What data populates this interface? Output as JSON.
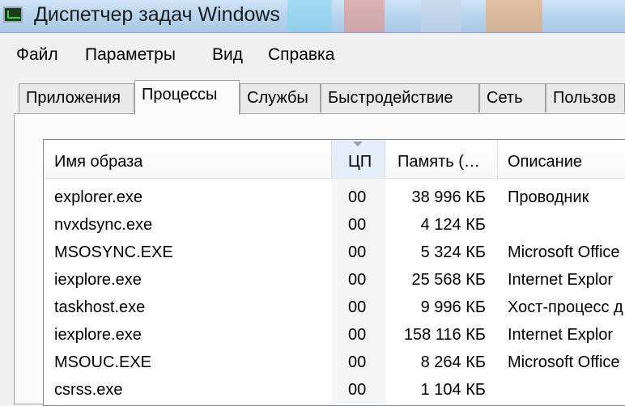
{
  "window": {
    "title": "Диспетчер задач Windows"
  },
  "menu": [
    "Файл",
    "Параметры",
    "Вид",
    "Справка"
  ],
  "tabs": [
    "Приложения",
    "Процессы",
    "Службы",
    "Быстродействие",
    "Сеть",
    "Пользов"
  ],
  "active_tab": "Процессы",
  "columns": [
    "Имя образа",
    "ЦП",
    "Память (…",
    "Описание"
  ],
  "sorted_column": "ЦП",
  "processes": [
    {
      "name": "explorer.exe",
      "cpu": "00",
      "memory": "38 996 КБ",
      "description": "Проводник"
    },
    {
      "name": "nvxdsync.exe",
      "cpu": "00",
      "memory": "4 124 КБ",
      "description": ""
    },
    {
      "name": "MSOSYNC.EXE",
      "cpu": "00",
      "memory": "5 324 КБ",
      "description": "Microsoft Office"
    },
    {
      "name": "iexplore.exe",
      "cpu": "00",
      "memory": "25 568 КБ",
      "description": "Internet Explor"
    },
    {
      "name": "taskhost.exe",
      "cpu": "00",
      "memory": "9 996 КБ",
      "description": "Хост-процесс д"
    },
    {
      "name": "iexplore.exe",
      "cpu": "00",
      "memory": "158 116 КБ",
      "description": "Internet Explor"
    },
    {
      "name": "MSOUC.EXE",
      "cpu": "00",
      "memory": "8 264 КБ",
      "description": "Microsoft Office"
    },
    {
      "name": "csrss.exe",
      "cpu": "00",
      "memory": "1 104 КБ",
      "description": ""
    }
  ]
}
